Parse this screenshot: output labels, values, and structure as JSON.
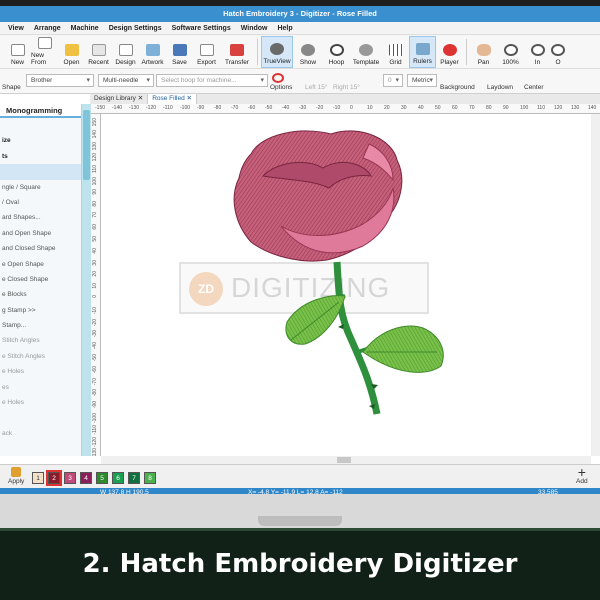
{
  "window": {
    "title": "Hatch Embroidery 3 - Digitizer - Rose Filled"
  },
  "menu": [
    "View",
    "Arrange",
    "Machine",
    "Design Settings",
    "Software Settings",
    "Window",
    "Help"
  ],
  "toolbar": [
    "New",
    "New From",
    "Open",
    "Recent",
    "Design",
    "Artwork",
    "Save",
    "Export",
    "Transfer",
    "TrueView",
    "Show",
    "Hoop",
    "Template",
    "Grid",
    "Rulers",
    "Player",
    "Pan",
    "100%",
    "In",
    "O"
  ],
  "options": {
    "shape_label": "Shape",
    "machine": "Brother",
    "needle": "Multi-needle",
    "hoop_placeholder": "Select hoop for machine...",
    "units": "Metric",
    "options_label": "Options",
    "left_angle": "Left 15°",
    "right_angle": "Right 15°",
    "number_value": "0",
    "background_label": "Background",
    "laydown_label": "Laydown",
    "center_label": "Center"
  },
  "tabs": [
    "Design Library",
    "Rose Filled"
  ],
  "panel": {
    "header": "Monogramming",
    "items": [
      "",
      "ize",
      "ts",
      "",
      "ngle / Square",
      "/ Oval",
      "ard Shapes...",
      "and Open Shape",
      "and Closed Shape",
      "e Open Shape",
      "e Closed Shape",
      "e Blocks",
      "g Stamp >>",
      "Stamp...",
      "Stitch Angles",
      "e Stitch Angles",
      "e Holes",
      "es",
      "e Holes",
      "",
      "ack"
    ]
  },
  "ruler": {
    "h_ticks": [
      "-150",
      "-140",
      "-130",
      "-120",
      "-110",
      "-100",
      "-90",
      "-80",
      "-70",
      "-60",
      "-50",
      "-40",
      "-30",
      "-20",
      "-10",
      "0",
      "10",
      "20",
      "30",
      "40",
      "50",
      "60",
      "70",
      "80",
      "90",
      "100",
      "110",
      "120",
      "130",
      "140"
    ],
    "v_ticks": [
      "150",
      "140",
      "130",
      "120",
      "110",
      "100",
      "90",
      "80",
      "70",
      "60",
      "50",
      "40",
      "30",
      "20",
      "10",
      "0",
      "-10",
      "-20",
      "-30",
      "-40",
      "-50",
      "-60",
      "-70",
      "-80",
      "-90",
      "-100",
      "-110",
      "-120",
      "-130"
    ]
  },
  "watermark": {
    "logo": "ZD",
    "text": "DIGITIZING"
  },
  "palette": {
    "apply_label": "Apply",
    "add_label": "Add",
    "swatches": [
      {
        "label": "1",
        "color": "#f3e0c8"
      },
      {
        "label": "2",
        "color": "#8b1c2c"
      },
      {
        "label": "3",
        "color": "#c04a7a"
      },
      {
        "label": "4",
        "color": "#8a1f5c"
      },
      {
        "label": "5",
        "color": "#2f8a2f"
      },
      {
        "label": "6",
        "color": "#1aa050"
      },
      {
        "label": "7",
        "color": "#127040"
      },
      {
        "label": "8",
        "color": "#4caf50"
      }
    ]
  },
  "status": {
    "size": "W 137.8 H 190.5",
    "coords": "X= -4.8 Y= -11.9 L= 12.8 A= -112",
    "stitches": "33,585"
  },
  "caption": "2. Hatch Embroidery Digitizer"
}
